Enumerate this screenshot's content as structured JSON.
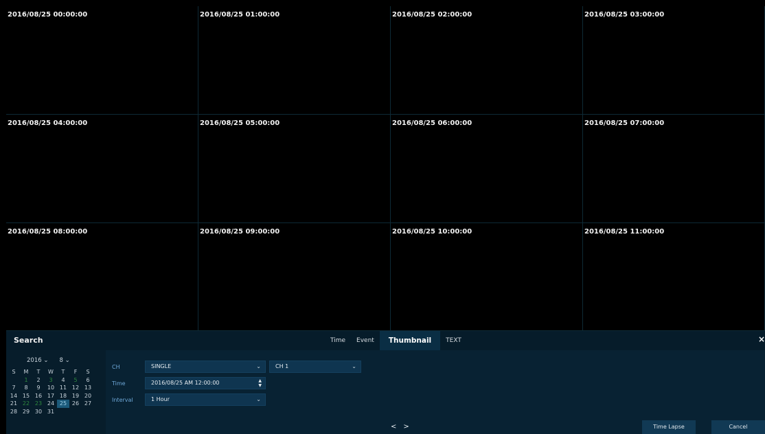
{
  "thumbnails": [
    "2016/08/25 00:00:00",
    "2016/08/25 01:00:00",
    "2016/08/25 02:00:00",
    "2016/08/25 03:00:00",
    "2016/08/25 04:00:00",
    "2016/08/25 05:00:00",
    "2016/08/25 06:00:00",
    "2016/08/25 07:00:00",
    "2016/08/25 08:00:00",
    "2016/08/25 09:00:00",
    "2016/08/25 10:00:00",
    "2016/08/25 11:00:00"
  ],
  "panel": {
    "title": "Search",
    "tabs": [
      "Time",
      "Event",
      "Thumbnail",
      "TEXT"
    ],
    "active_tab": "Thumbnail",
    "close_glyph": "×"
  },
  "calendar": {
    "year": "2016",
    "month": "8",
    "weekdays": [
      "S",
      "M",
      "T",
      "W",
      "T",
      "F",
      "S"
    ],
    "weeks": [
      [
        "",
        "1",
        "2",
        "3",
        "4",
        "5",
        "6"
      ],
      [
        "7",
        "8",
        "9",
        "10",
        "11",
        "12",
        "13"
      ],
      [
        "14",
        "15",
        "16",
        "17",
        "18",
        "19",
        "20"
      ],
      [
        "21",
        "22",
        "23",
        "24",
        "25",
        "26",
        "27"
      ],
      [
        "28",
        "29",
        "30",
        "31",
        "",
        "",
        ""
      ]
    ],
    "selected_day": "25",
    "recorded_days": [
      "1",
      "3",
      "5",
      "22",
      "23"
    ]
  },
  "form": {
    "ch_label": "CH",
    "ch_mode": "SINGLE",
    "ch_channel": "CH 1",
    "time_label": "Time",
    "time_value": "2016/08/25 AM 12:00:00",
    "interval_label": "Interval",
    "interval_value": "1 Hour"
  },
  "pager": {
    "prev": "<",
    "next": ">"
  },
  "buttons": {
    "time_lapse": "Time Lapse",
    "cancel": "Cancel"
  },
  "icons": {
    "dropdown": "chevron-down-icon",
    "spin": "spin-updown-icon",
    "close": "close-icon"
  }
}
